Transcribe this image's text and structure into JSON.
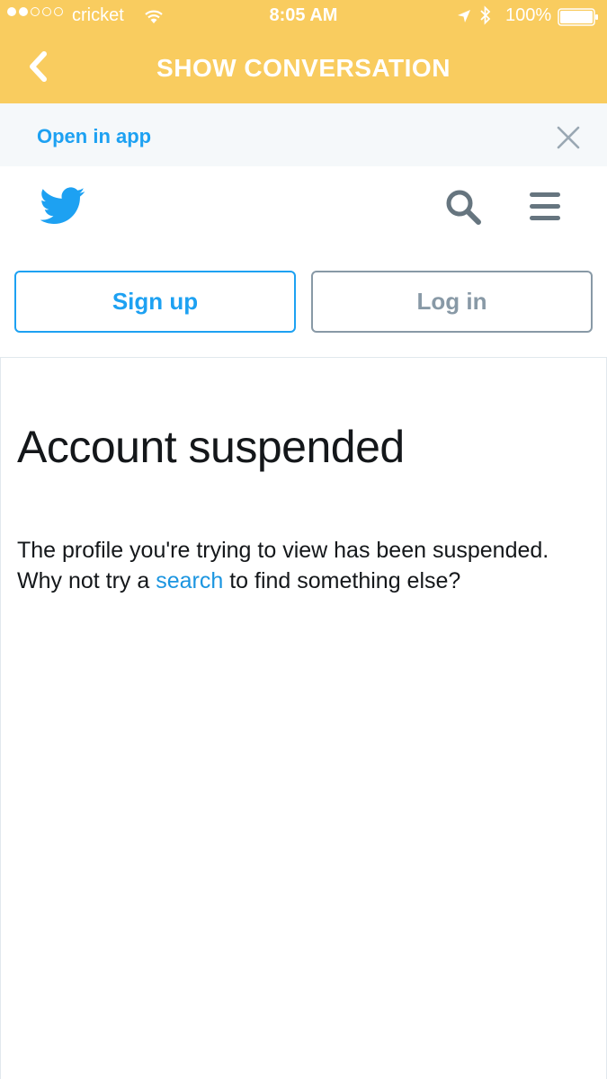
{
  "status_bar": {
    "carrier": "cricket",
    "time": "8:05 AM",
    "battery": "100%",
    "signal_icon": "signal-dots-icon",
    "wifi_icon": "wifi-icon",
    "location_icon": "location-arrow-icon",
    "bluetooth_icon": "bluetooth-icon",
    "battery_icon": "battery-icon"
  },
  "nav": {
    "title": "SHOW CONVERSATION",
    "back_icon": "chevron-left-icon",
    "background_color": "#F9CC5F"
  },
  "banner": {
    "link_label": "Open in app",
    "close_icon": "close-icon"
  },
  "header": {
    "logo_icon": "twitter-bird-icon",
    "search_icon": "search-icon",
    "menu_icon": "hamburger-menu-icon"
  },
  "auth": {
    "signup_label": "Sign up",
    "login_label": "Log in"
  },
  "content": {
    "title": "Account suspended",
    "text_before": "The profile you're trying to view has been suspended. Why not try a ",
    "link_text": "search",
    "text_after": " to find something else?"
  },
  "colors": {
    "accent": "#1DA1F2",
    "link": "#1B95E0",
    "muted": "#8899A6"
  }
}
